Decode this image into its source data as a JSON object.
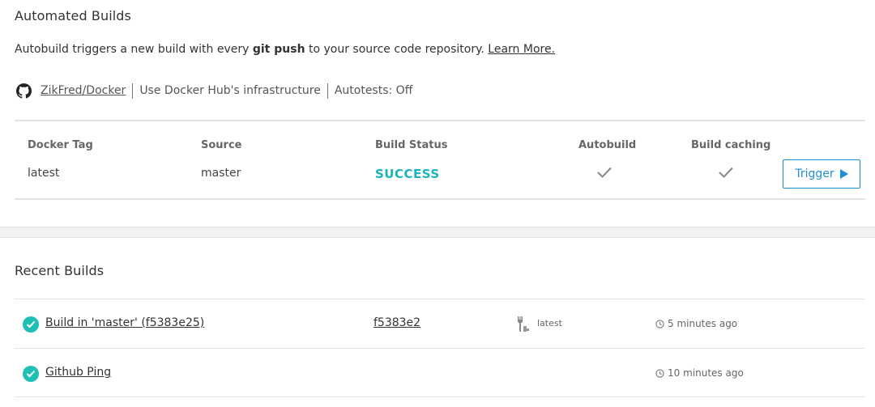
{
  "automated_builds": {
    "title": "Automated Builds",
    "description": {
      "prefix": "Autobuild triggers a new build with every ",
      "bold": "git push",
      "suffix": " to your source code repository. ",
      "link": "Learn More."
    },
    "source": {
      "icon": "github-icon",
      "repo": "ZikFred/Docker",
      "infrastructure": "Use Docker Hub's infrastructure",
      "autotests": "Autotests: Off"
    },
    "table": {
      "headers": {
        "docker_tag": "Docker Tag",
        "source": "Source",
        "build_status": "Build Status",
        "autobuild": "Autobuild",
        "build_caching": "Build caching"
      },
      "row": {
        "docker_tag": "latest",
        "source": "master",
        "build_status": "SUCCESS",
        "autobuild": true,
        "build_caching": true,
        "trigger_label": "Trigger"
      }
    }
  },
  "recent_builds": {
    "title": "Recent Builds",
    "items": [
      {
        "status": "success",
        "name": "Build in 'master' (f5383e25)",
        "commit": "f5383e2",
        "tag": "latest",
        "time": "5 minutes ago"
      },
      {
        "status": "success",
        "name": "Github Ping",
        "time": "10 minutes ago"
      }
    ]
  },
  "colors": {
    "success": "#1ab3b8",
    "success_badge": "#1ec0b6",
    "primary": "#1d8fd6",
    "check_gray": "#888888"
  }
}
